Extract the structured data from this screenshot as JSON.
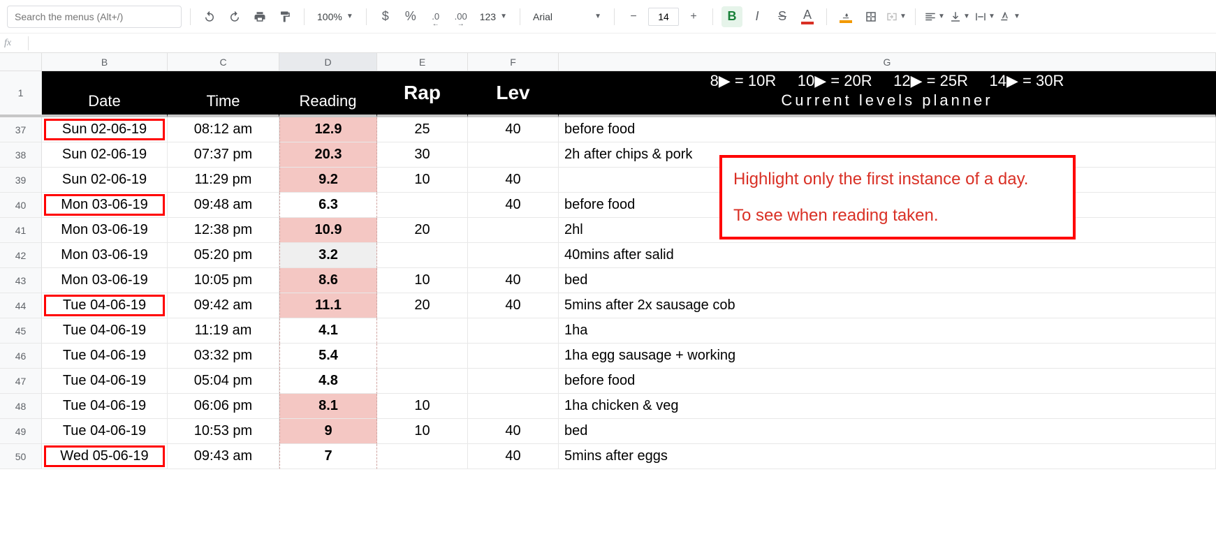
{
  "toolbar": {
    "search_placeholder": "Search the menus (Alt+/)",
    "zoom": "100%",
    "currency": "$",
    "percent": "%",
    "dec_dec": ".0",
    "inc_dec": ".00",
    "more_formats": "123",
    "font_name": "Arial",
    "font_size": "14",
    "bold": "B",
    "italic": "I",
    "strike": "S",
    "text_color_letter": "A"
  },
  "formula_bar": {
    "fx": "fx",
    "value": ""
  },
  "columns": [
    "B",
    "C",
    "D",
    "E",
    "F",
    "G"
  ],
  "header_row": {
    "row_num": "1",
    "date": "Date",
    "time": "Time",
    "reading": "Reading",
    "rap": "Rap",
    "lev": "Lev",
    "g_line1": "8▶ = 10R     10▶ = 20R     12▶ = 25R     14▶ = 30R",
    "g_line2": "Current levels planner"
  },
  "rows": [
    {
      "n": "37",
      "date": "Sun 02-06-19",
      "time": "08:12 am",
      "reading": "12.9",
      "rap": "25",
      "lev": "40",
      "note": "before food",
      "first": true,
      "rcolor": "pink"
    },
    {
      "n": "38",
      "date": "Sun 02-06-19",
      "time": "07:37 pm",
      "reading": "20.3",
      "rap": "30",
      "lev": "",
      "note": "2h after chips & pork",
      "first": false,
      "rcolor": "pink"
    },
    {
      "n": "39",
      "date": "Sun 02-06-19",
      "time": "11:29 pm",
      "reading": "9.2",
      "rap": "10",
      "lev": "40",
      "note": "",
      "first": false,
      "rcolor": "pink"
    },
    {
      "n": "40",
      "date": "Mon 03-06-19",
      "time": "09:48 am",
      "reading": "6.3",
      "rap": "",
      "lev": "40",
      "note": "before food",
      "first": true,
      "rcolor": ""
    },
    {
      "n": "41",
      "date": "Mon 03-06-19",
      "time": "12:38 pm",
      "reading": "10.9",
      "rap": "20",
      "lev": "",
      "note": "2hl",
      "first": false,
      "rcolor": "pink"
    },
    {
      "n": "42",
      "date": "Mon 03-06-19",
      "time": "05:20 pm",
      "reading": "3.2",
      "rap": "",
      "lev": "",
      "note": "40mins after salid",
      "first": false,
      "rcolor": "grey"
    },
    {
      "n": "43",
      "date": "Mon 03-06-19",
      "time": "10:05 pm",
      "reading": "8.6",
      "rap": "10",
      "lev": "40",
      "note": "bed",
      "first": false,
      "rcolor": "pink"
    },
    {
      "n": "44",
      "date": "Tue 04-06-19",
      "time": "09:42 am",
      "reading": "11.1",
      "rap": "20",
      "lev": "40",
      "note": "5mins after 2x sausage cob",
      "first": true,
      "rcolor": "pink"
    },
    {
      "n": "45",
      "date": "Tue 04-06-19",
      "time": "11:19 am",
      "reading": "4.1",
      "rap": "",
      "lev": "",
      "note": "1ha",
      "first": false,
      "rcolor": ""
    },
    {
      "n": "46",
      "date": "Tue 04-06-19",
      "time": "03:32 pm",
      "reading": "5.4",
      "rap": "",
      "lev": "",
      "note": "1ha egg sausage + working",
      "first": false,
      "rcolor": ""
    },
    {
      "n": "47",
      "date": "Tue 04-06-19",
      "time": "05:04 pm",
      "reading": "4.8",
      "rap": "",
      "lev": "",
      "note": "before food",
      "first": false,
      "rcolor": ""
    },
    {
      "n": "48",
      "date": "Tue 04-06-19",
      "time": "06:06 pm",
      "reading": "8.1",
      "rap": "10",
      "lev": "",
      "note": "1ha chicken & veg",
      "first": false,
      "rcolor": "pink"
    },
    {
      "n": "49",
      "date": "Tue 04-06-19",
      "time": "10:53 pm",
      "reading": "9",
      "rap": "10",
      "lev": "40",
      "note": "bed",
      "first": false,
      "rcolor": "pink"
    },
    {
      "n": "50",
      "date": "Wed 05-06-19",
      "time": "09:43 am",
      "reading": "7",
      "rap": "",
      "lev": "40",
      "note": "5mins after eggs",
      "first": true,
      "rcolor": ""
    }
  ],
  "annotation": {
    "line1": "Highlight only the first instance of a day.",
    "line2": "To see when reading taken."
  }
}
